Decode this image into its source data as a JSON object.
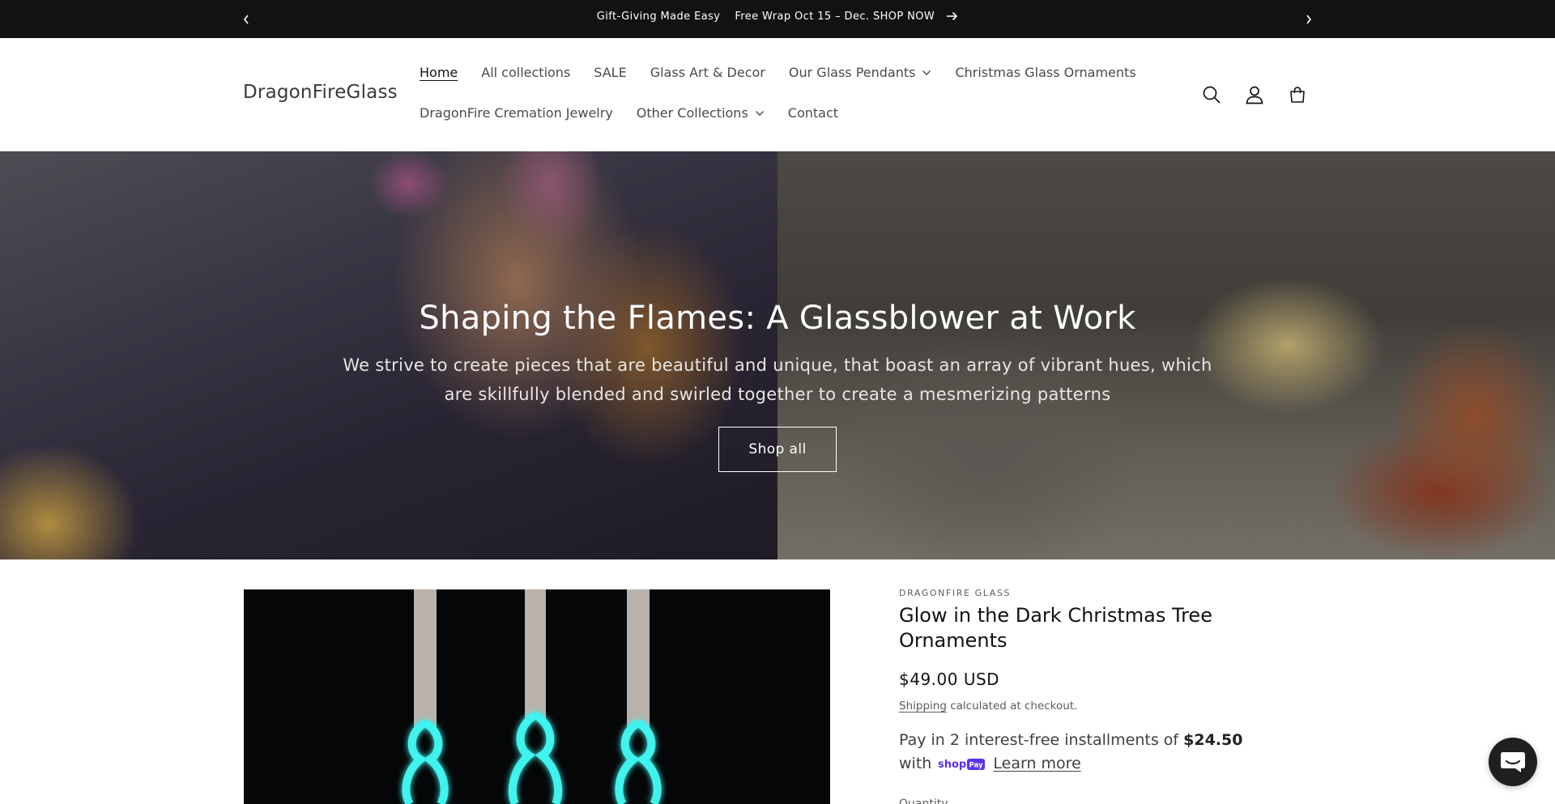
{
  "announcement": {
    "text_1": "Gift-Giving Made Easy",
    "text_2": "Free Wrap Oct 15 – Dec. SHOP NOW",
    "prev_icon": "chevron-left-icon",
    "next_icon": "chevron-right-icon",
    "arrow_icon": "arrow-right-icon"
  },
  "header": {
    "logo": "DragonFireGlass",
    "nav_row_1": [
      {
        "label": "Home",
        "active": true
      },
      {
        "label": "All collections"
      },
      {
        "label": "SALE"
      },
      {
        "label": "Glass Art & Decor"
      },
      {
        "label": "Our Glass Pendants",
        "dropdown": true
      },
      {
        "label": "Christmas Glass Ornaments"
      }
    ],
    "nav_row_2": [
      {
        "label": "DragonFire Cremation Jewelry"
      },
      {
        "label": "Other Collections",
        "dropdown": true
      },
      {
        "label": "Contact"
      }
    ],
    "icons": [
      "search-icon",
      "account-icon",
      "cart-icon"
    ]
  },
  "hero": {
    "title": "Shaping the Flames: A Glassblower at Work",
    "text": "We strive to create pieces that are beautiful and unique, that boast an array of vibrant hues, which are skillfully blended and swirled together to create a mesmerizing patterns",
    "button": "Shop all"
  },
  "product": {
    "vendor": "DRAGONFIRE GLASS",
    "title": "Glow in the Dark Christmas Tree Ornaments",
    "price": "$49.00 USD",
    "shipping_link": "Shipping",
    "shipping_text": " calculated at checkout.",
    "installments_text": "Pay in 2 interest-free installments of ",
    "installments_amount": "$24.50",
    "installments_with": "with",
    "shoppay_label": "shop Pay",
    "learn_more": "Learn more",
    "quantity_label": "Quantity"
  },
  "colors": {
    "announcement_bg": "#121212",
    "text": "#121212",
    "shoppay": "#5a31f4",
    "ornament_glow": "#3ff3ee"
  },
  "chat": {
    "icon": "chat-icon"
  }
}
